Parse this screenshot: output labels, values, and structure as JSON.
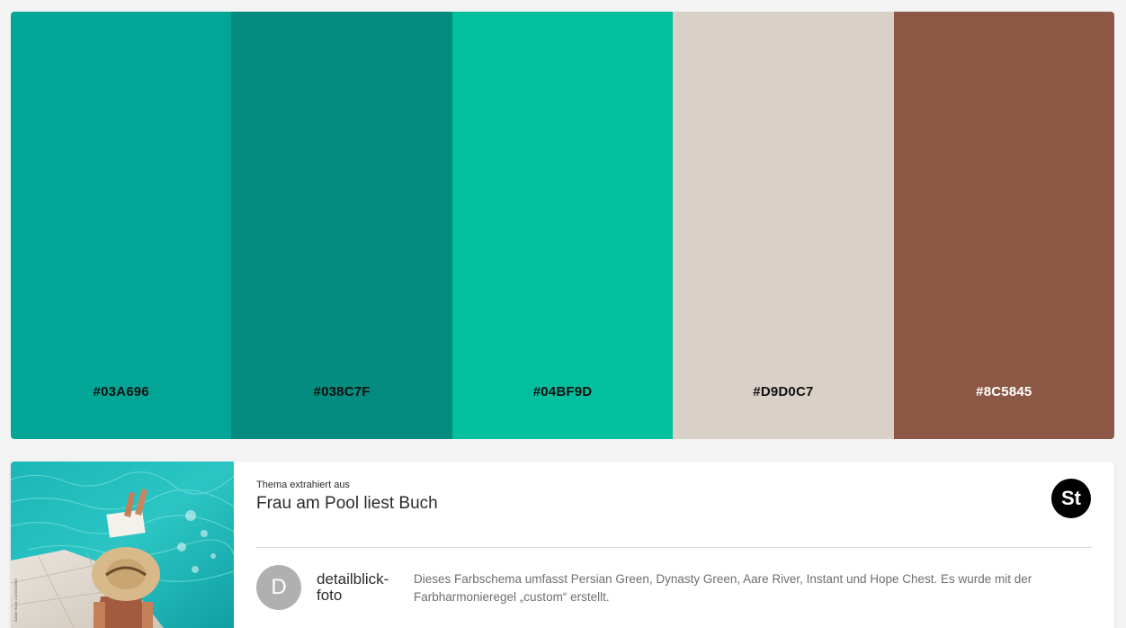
{
  "palette": {
    "swatches": [
      {
        "hex": "#03A696",
        "text_color": "#111111"
      },
      {
        "hex": "#038C7F",
        "text_color": "#111111"
      },
      {
        "hex": "#04BF9D",
        "text_color": "#111111"
      },
      {
        "hex": "#D9D0C7",
        "text_color": "#111111"
      },
      {
        "hex": "#8C5845",
        "text_color": "#ffffff"
      }
    ]
  },
  "theme_card": {
    "extracted_label": "Thema extrahiert aus",
    "title": "Frau am Pool liest Buch",
    "badge_label": "St",
    "author_initial": "D",
    "author_name": "detailblick-foto",
    "description": "Dieses Farbschema umfasst Persian Green, Dynasty Green, Aare River, Instant und Hope Chest. Es wurde mit der Farbharmonieregel „custom“ erstellt.",
    "thumbnail_watermark": "Adobe Stock | #235319962"
  }
}
